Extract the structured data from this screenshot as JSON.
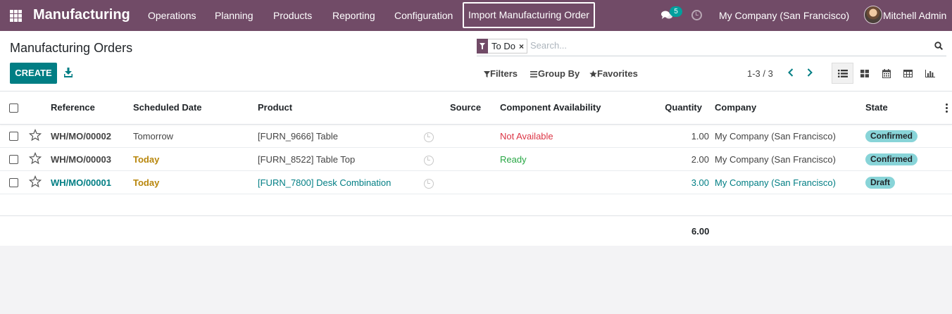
{
  "navbar": {
    "brand": "Manufacturing",
    "menus": [
      "Operations",
      "Planning",
      "Products",
      "Reporting",
      "Configuration"
    ],
    "import_button": "Import Manufacturing Order",
    "message_count": "5",
    "company": "My Company (San Francisco)",
    "user": "Mitchell Admin",
    "accent_color": "#714b67"
  },
  "control": {
    "title": "Manufacturing Orders",
    "create_label": "CREATE",
    "facet_label": "To Do",
    "search_placeholder": "Search...",
    "filters_label": "Filters",
    "groupby_label": "Group By",
    "favorites_label": "Favorites",
    "pager": "1-3 / 3",
    "views": [
      "list-view-icon",
      "kanban-view-icon",
      "calendar-view-icon",
      "pivot-view-icon",
      "graph-view-icon"
    ],
    "active_view": "list"
  },
  "table": {
    "headers": {
      "reference": "Reference",
      "scheduled_date": "Scheduled Date",
      "product": "Product",
      "source": "Source",
      "component_availability": "Component Availability",
      "quantity": "Quantity",
      "company": "Company",
      "state": "State"
    },
    "rows": [
      {
        "reference": "WH/MO/00002",
        "scheduled_date": "Tomorrow",
        "product": "[FURN_9666] Table",
        "source": "",
        "component_availability": "Not Available",
        "quantity": "1.00",
        "company": "My Company (San Francisco)",
        "state": "Confirmed"
      },
      {
        "reference": "WH/MO/00003",
        "scheduled_date": "Today",
        "product": "[FURN_8522] Table Top",
        "source": "",
        "component_availability": "Ready",
        "quantity": "2.00",
        "company": "My Company (San Francisco)",
        "state": "Confirmed"
      },
      {
        "reference": "WH/MO/00001",
        "scheduled_date": "Today",
        "product": "[FURN_7800] Desk Combination",
        "source": "",
        "component_availability": "",
        "quantity": "3.00",
        "company": "My Company (San Francisco)",
        "state": "Draft"
      }
    ],
    "total_quantity": "6.00",
    "colors": {
      "not_available": "#dc3545",
      "ready": "#28a745",
      "today": "#b8860b",
      "link": "#017e84",
      "state_pill": "#88d4d8"
    }
  }
}
